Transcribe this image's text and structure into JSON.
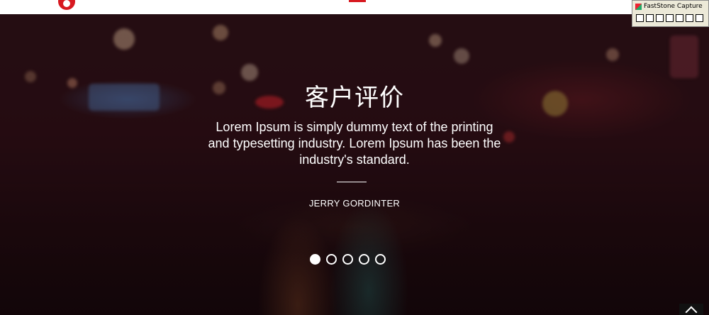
{
  "testimonial": {
    "heading": "客户评价",
    "quote": "Lorem Ipsum is simply dummy text of the printing and typesetting industry. Lorem Ipsum has been the industry's standard.",
    "author": "JERRY GORDINTER"
  },
  "carousel": {
    "slide_count": 5,
    "active_index": 0
  },
  "colors": {
    "brand_red": "#d71920",
    "text": "#ffffff"
  },
  "faststone": {
    "title": "FastStone Capture",
    "tool_icons": [
      "capture-window-icon",
      "capture-object-icon",
      "capture-rectangle-icon",
      "capture-freehand-icon",
      "capture-fullscreen-icon",
      "capture-scrolling-icon"
    ]
  },
  "icons": {
    "scroll_top": "chevron-up-icon",
    "logo": "brand-logo"
  }
}
